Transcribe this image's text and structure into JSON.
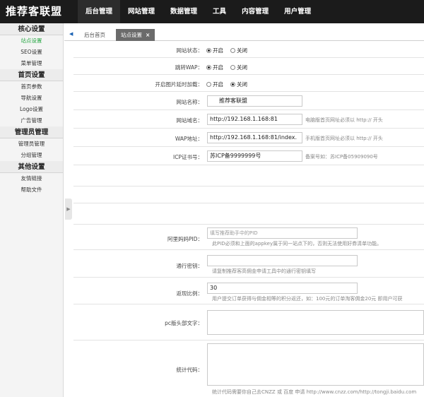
{
  "header": {
    "logo": "推荐客联盟",
    "nav": [
      "后台管理",
      "网站管理",
      "数据管理",
      "工具",
      "内容管理",
      "用户管理"
    ]
  },
  "sidebar": {
    "sections": [
      {
        "title": "核心设置",
        "items": [
          "站点设置",
          "SEO设置",
          "菜单管理"
        ]
      },
      {
        "title": "首页设置",
        "items": [
          "首页参数",
          "导航设置",
          "Logo设置",
          "广告管理"
        ]
      },
      {
        "title": "管理员管理",
        "items": [
          "管理员管理",
          "分组管理"
        ]
      },
      {
        "title": "其他设置",
        "items": [
          "友情链接",
          "帮助文件"
        ]
      }
    ],
    "active_item": "站点设置"
  },
  "tabs": {
    "home": "后台首页",
    "current": "站点设置",
    "close": "×"
  },
  "form": {
    "site_status": {
      "label": "网站状态：",
      "on": "开启",
      "off": "关闭",
      "selected": "on"
    },
    "wap_redirect": {
      "label": "跳转WAP：",
      "on": "开启",
      "off": "关闭",
      "selected": "on"
    },
    "lazy_load": {
      "label": "开启图片延时加载：",
      "on": "开启",
      "off": "关闭",
      "selected": "off"
    },
    "site_name": {
      "label": "网站名称：",
      "value": "推荐客联盟"
    },
    "site_domain": {
      "label": "网站域名：",
      "value": "http://192.168.1.168:81",
      "hint": "电脑版首页网址必须以 http:// 开头"
    },
    "wap_address": {
      "label": "WAP地址：",
      "value": "http://192.168.1.168:81/index.",
      "hint": "手机版首页网址必须以 http:// 开头"
    },
    "icp": {
      "label": "ICP证书号：",
      "value": "苏ICP备9999999号",
      "hint": "备案号如：苏ICP备05909090号"
    },
    "pid": {
      "label": "阿里妈妈PID：",
      "placeholder": "填写推荐助手中的PID",
      "hint": "此PID必须和上面的appkey属于同一站点下的，否则无法使用好券清单功能。"
    },
    "secret": {
      "label": "通行密钥：",
      "value": "",
      "hint": "请复制推荐客高佣金申请工具中的通行密钥填写"
    },
    "ratio": {
      "label": "返现比例：",
      "value": "30",
      "hint": "用户提交订单获得与佣金相等的积分返还，如：100元的订单淘客佣金20元 即用户可获"
    },
    "pc_header": {
      "label": "pc版头部文字："
    },
    "stats_code": {
      "label": "统计代码：",
      "hint": "统计代码需要你自己去CNZZ 或 百度 申请 http://www.cnzz.com/http://tongji.baidu.com"
    }
  }
}
